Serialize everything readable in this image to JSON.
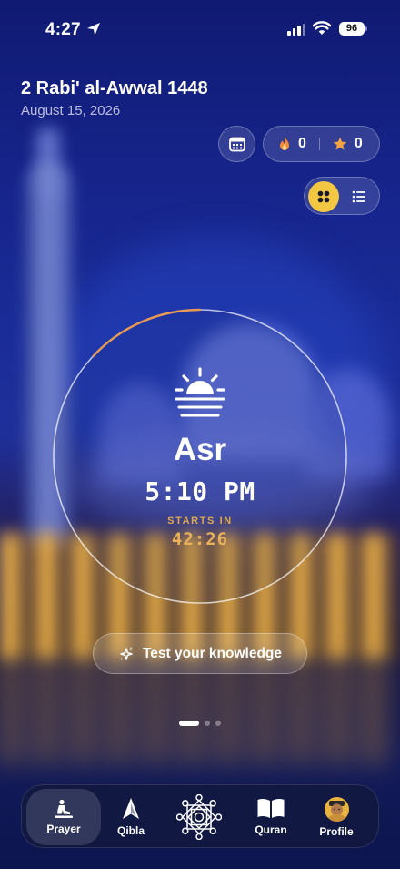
{
  "status_bar": {
    "time": "4:27",
    "battery": "96"
  },
  "header": {
    "hijri_date": "2 Rabi' al-Awwal 1448",
    "gregorian_date": "August 15, 2026"
  },
  "stats": {
    "streak": "0",
    "stars": "0"
  },
  "prayer": {
    "name": "Asr",
    "time": "5:10 PM",
    "starts_label": "STARTS IN",
    "countdown": "42:26",
    "ring_progress": 0.13
  },
  "quiz_button": {
    "label": "Test your knowledge"
  },
  "pagination": {
    "pages": 3,
    "active": 0
  },
  "tabs": [
    {
      "label": "Prayer",
      "icon": "prayer-mat-icon",
      "active": true
    },
    {
      "label": "Qibla",
      "icon": "compass-arrow-icon"
    },
    {
      "label": "",
      "icon": "islamic-star-icon"
    },
    {
      "label": "Quran",
      "icon": "book-icon"
    },
    {
      "label": "Profile",
      "icon": "avatar"
    }
  ],
  "colors": {
    "accent_gold": "#f2c744",
    "countdown": "#e8b15a",
    "ring_progress": "#e89a55"
  }
}
